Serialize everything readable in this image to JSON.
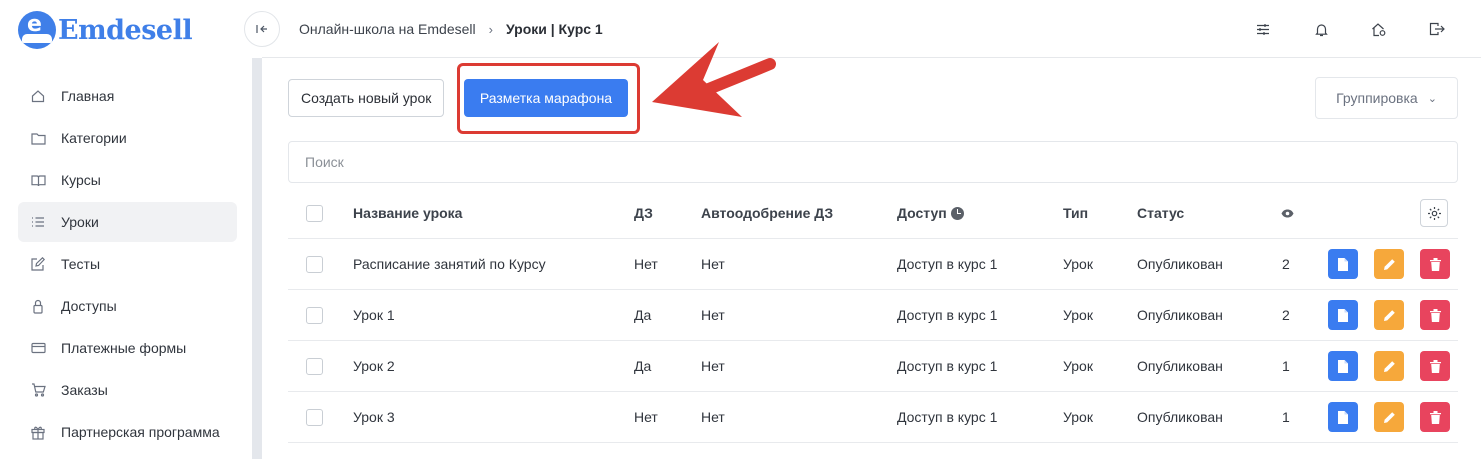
{
  "brand": {
    "name": "Emdesell",
    "accent": "#3f7fe8"
  },
  "sidebar": {
    "items": [
      {
        "label": "Главная",
        "icon": "home-icon"
      },
      {
        "label": "Категории",
        "icon": "folder-icon"
      },
      {
        "label": "Курсы",
        "icon": "book-icon"
      },
      {
        "label": "Уроки",
        "icon": "list-icon",
        "active": true
      },
      {
        "label": "Тесты",
        "icon": "edit-icon"
      },
      {
        "label": "Доступы",
        "icon": "lock-icon"
      },
      {
        "label": "Платежные формы",
        "icon": "card-icon"
      },
      {
        "label": "Заказы",
        "icon": "cart-icon"
      },
      {
        "label": "Партнерская программа",
        "icon": "gift-icon"
      }
    ]
  },
  "header": {
    "breadcrumbs": [
      "Онлайн-школа на Emdesell",
      "Уроки | Курс 1"
    ],
    "icons": [
      "sliders-icon",
      "bell-icon",
      "home-settings-icon",
      "logout-icon"
    ]
  },
  "toolbar": {
    "create_label": "Создать новый урок",
    "marathon_label": "Разметка марафона",
    "grouping_label": "Группировка"
  },
  "search": {
    "placeholder": "Поиск"
  },
  "table": {
    "columns": {
      "name": "Название урока",
      "dz": "ДЗ",
      "auto": "Автоодобрение ДЗ",
      "access": "Доступ",
      "type": "Тип",
      "status": "Статус"
    },
    "rows": [
      {
        "name": "Расписание занятий по Курсу",
        "dz": "Нет",
        "auto": "Нет",
        "access": "Доступ в курс 1",
        "type": "Урок",
        "status": "Опубликован",
        "views": "2"
      },
      {
        "name": "Урок 1",
        "dz": "Да",
        "auto": "Нет",
        "access": "Доступ в курс 1",
        "type": "Урок",
        "status": "Опубликован",
        "views": "2"
      },
      {
        "name": "Урок 2",
        "dz": "Да",
        "auto": "Нет",
        "access": "Доступ в курс 1",
        "type": "Урок",
        "status": "Опубликован",
        "views": "1"
      },
      {
        "name": "Урок 3",
        "dz": "Нет",
        "auto": "Нет",
        "access": "Доступ в курс 1",
        "type": "Урок",
        "status": "Опубликован",
        "views": "1"
      }
    ]
  },
  "colors": {
    "primary": "#3a7cf0",
    "warning": "#f6a83b",
    "danger": "#e8445e",
    "annotation": "#dc3b33"
  }
}
